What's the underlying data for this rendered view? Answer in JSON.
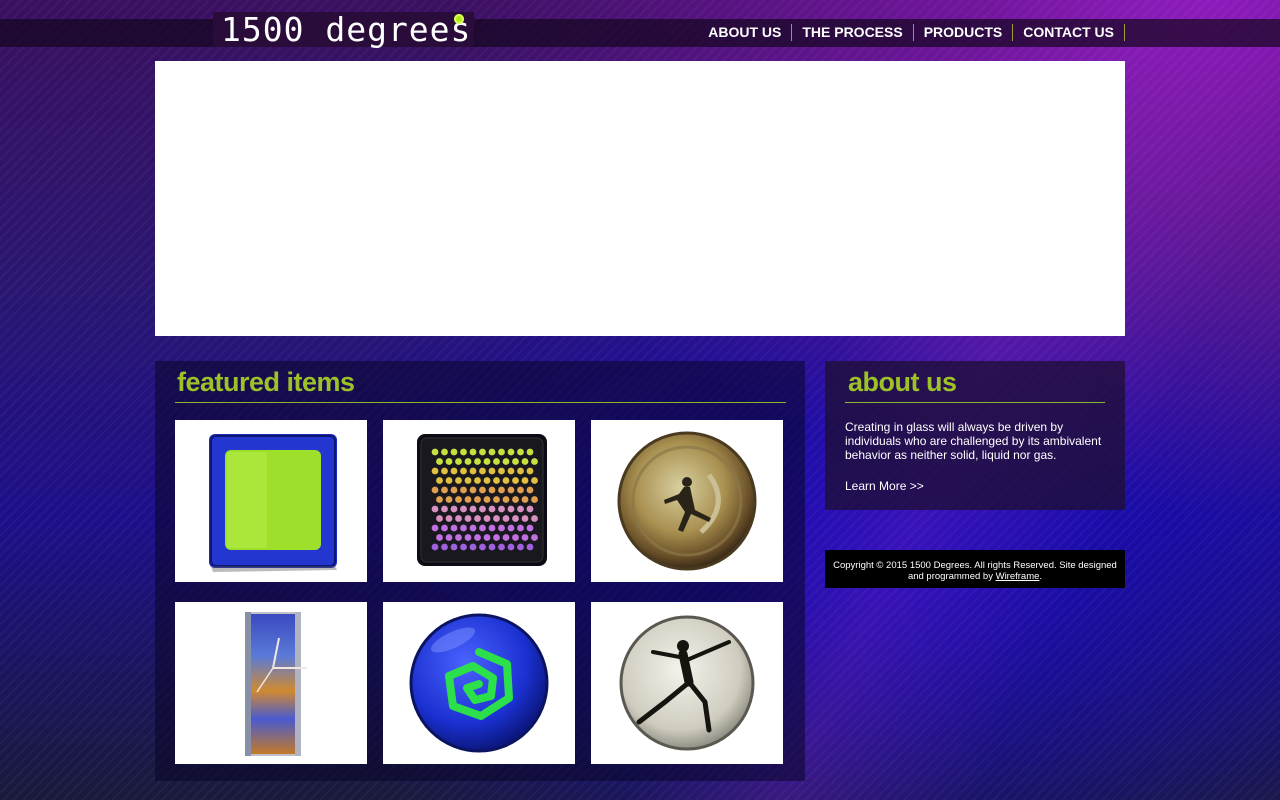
{
  "brand": {
    "logo_text": "1500 degrees"
  },
  "nav": [
    {
      "label": "ABOUT US"
    },
    {
      "label": "THE PROCESS"
    },
    {
      "label": "PRODUCTS"
    },
    {
      "label": "CONTACT US"
    }
  ],
  "featured": {
    "title": "featured items",
    "items": [
      {
        "icon": "glass-square-dish-blue-green"
      },
      {
        "icon": "glass-dot-pattern-dish"
      },
      {
        "icon": "glass-round-gold-figure"
      },
      {
        "icon": "glass-clock-rectangle"
      },
      {
        "icon": "glass-round-blue-spiral"
      },
      {
        "icon": "glass-round-silver-dancer"
      }
    ]
  },
  "about": {
    "title": "about us",
    "text": "Creating in glass will always be driven by individuals who are challenged by its ambivalent behavior as neither solid, liquid nor gas.",
    "link": "Learn More >>"
  },
  "footer": {
    "text": "Copyright © 2015 1500 Degrees. All rights Reserved. Site designed and programmed by",
    "link": "Wireframe",
    "suffix": "."
  },
  "colors": {
    "accent": "#9cc228",
    "logo_dot": "#b5e61d"
  }
}
